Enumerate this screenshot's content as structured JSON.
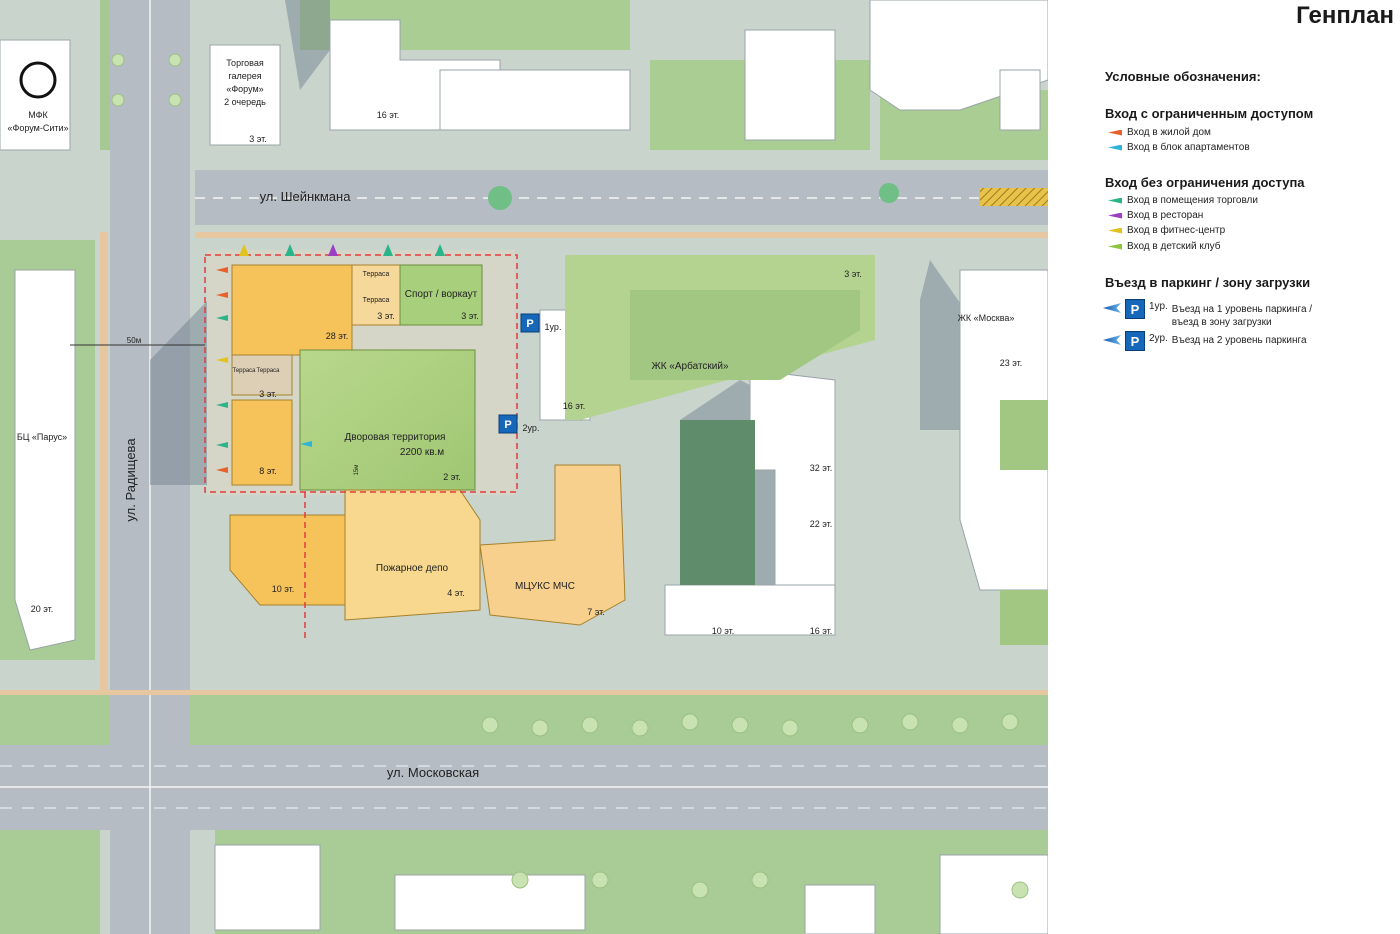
{
  "title": "Генплан",
  "legend": {
    "heading": "Условные обозначения:",
    "restricted": {
      "heading": "Вход  с ограниченным доступом",
      "items": [
        {
          "label": "Вход в жилой дом",
          "color": "#e8612c"
        },
        {
          "label": "Вход в блок апартаментов",
          "color": "#2fb3d6"
        }
      ]
    },
    "unrestricted": {
      "heading": "Вход  без ограничения доступа",
      "items": [
        {
          "label": "Вход в помещения торговли",
          "color": "#2bb38a"
        },
        {
          "label": "Вход в ресторан",
          "color": "#9b3fc4"
        },
        {
          "label": "Вход в фитнес-центр",
          "color": "#e1c21e"
        },
        {
          "label": "Вход в детский клуб",
          "color": "#8cc63f"
        }
      ]
    },
    "parking": {
      "heading": "Въезд в паркинг / зону загрузки",
      "items": [
        {
          "symbol": "P",
          "level": "1ур.",
          "label_line1": "Въезд на 1 уровень паркинга /",
          "label_line2": "въезд в зону загрузки"
        },
        {
          "symbol": "P",
          "level": "2ур.",
          "label_line1": "Въезд на 2 уровень паркинга",
          "label_line2": ""
        }
      ]
    }
  },
  "map": {
    "streets": {
      "sheinkman": "ул. Шейнкмана",
      "radishcheva": "ул. Радищева",
      "moskovskaya": "ул. Московская"
    },
    "buildings": {
      "forum_city_line1": "МФК",
      "forum_city_line2": "«Форум-Сити»",
      "gallery_line1": "Торговая",
      "gallery_line2": "галерея",
      "gallery_line3": "«Форум»",
      "gallery_line4": "2 очередь",
      "gallery_floors": "3 эт.",
      "north_16": "16 эт.",
      "parus": "БЦ «Парус»",
      "parus_floors": "20 эт.",
      "b28": "28 эт.",
      "terrace1": "Терраса",
      "terrace2": "Терраса",
      "sport": "Спорт / воркаут",
      "sport_floors": "3 эт.",
      "n3_floors": "3 эт.",
      "terrace3": "Терраса",
      "terrace4": "Терраса",
      "mid3": "3 эт.",
      "b8": "8 эт.",
      "yard_line1": "Дворовая территория",
      "yard_line2": "2200 кв.м",
      "yard_floors": "2 эт.",
      "b10": "10 эт.",
      "fire_depot": "Пожарное депо",
      "fire_floors": "4 эт.",
      "mchs": "МЦУКС  МЧС",
      "mchs_floors": "7 эт.",
      "arbat": "ЖК «Арбатский»",
      "arbat_3": "3 эт.",
      "arbat_16": "16 эт.",
      "moskva": "ЖК «Москва»",
      "moskva_23": "23 эт.",
      "e32": "32 эт.",
      "e22": "22 эт.",
      "e10": "10 эт.",
      "e16": "16 эт.",
      "dim": "50м",
      "dim_small": "15м",
      "p1": "1ур.",
      "p2": "2ур.",
      "p_symbol": "P"
    }
  }
}
